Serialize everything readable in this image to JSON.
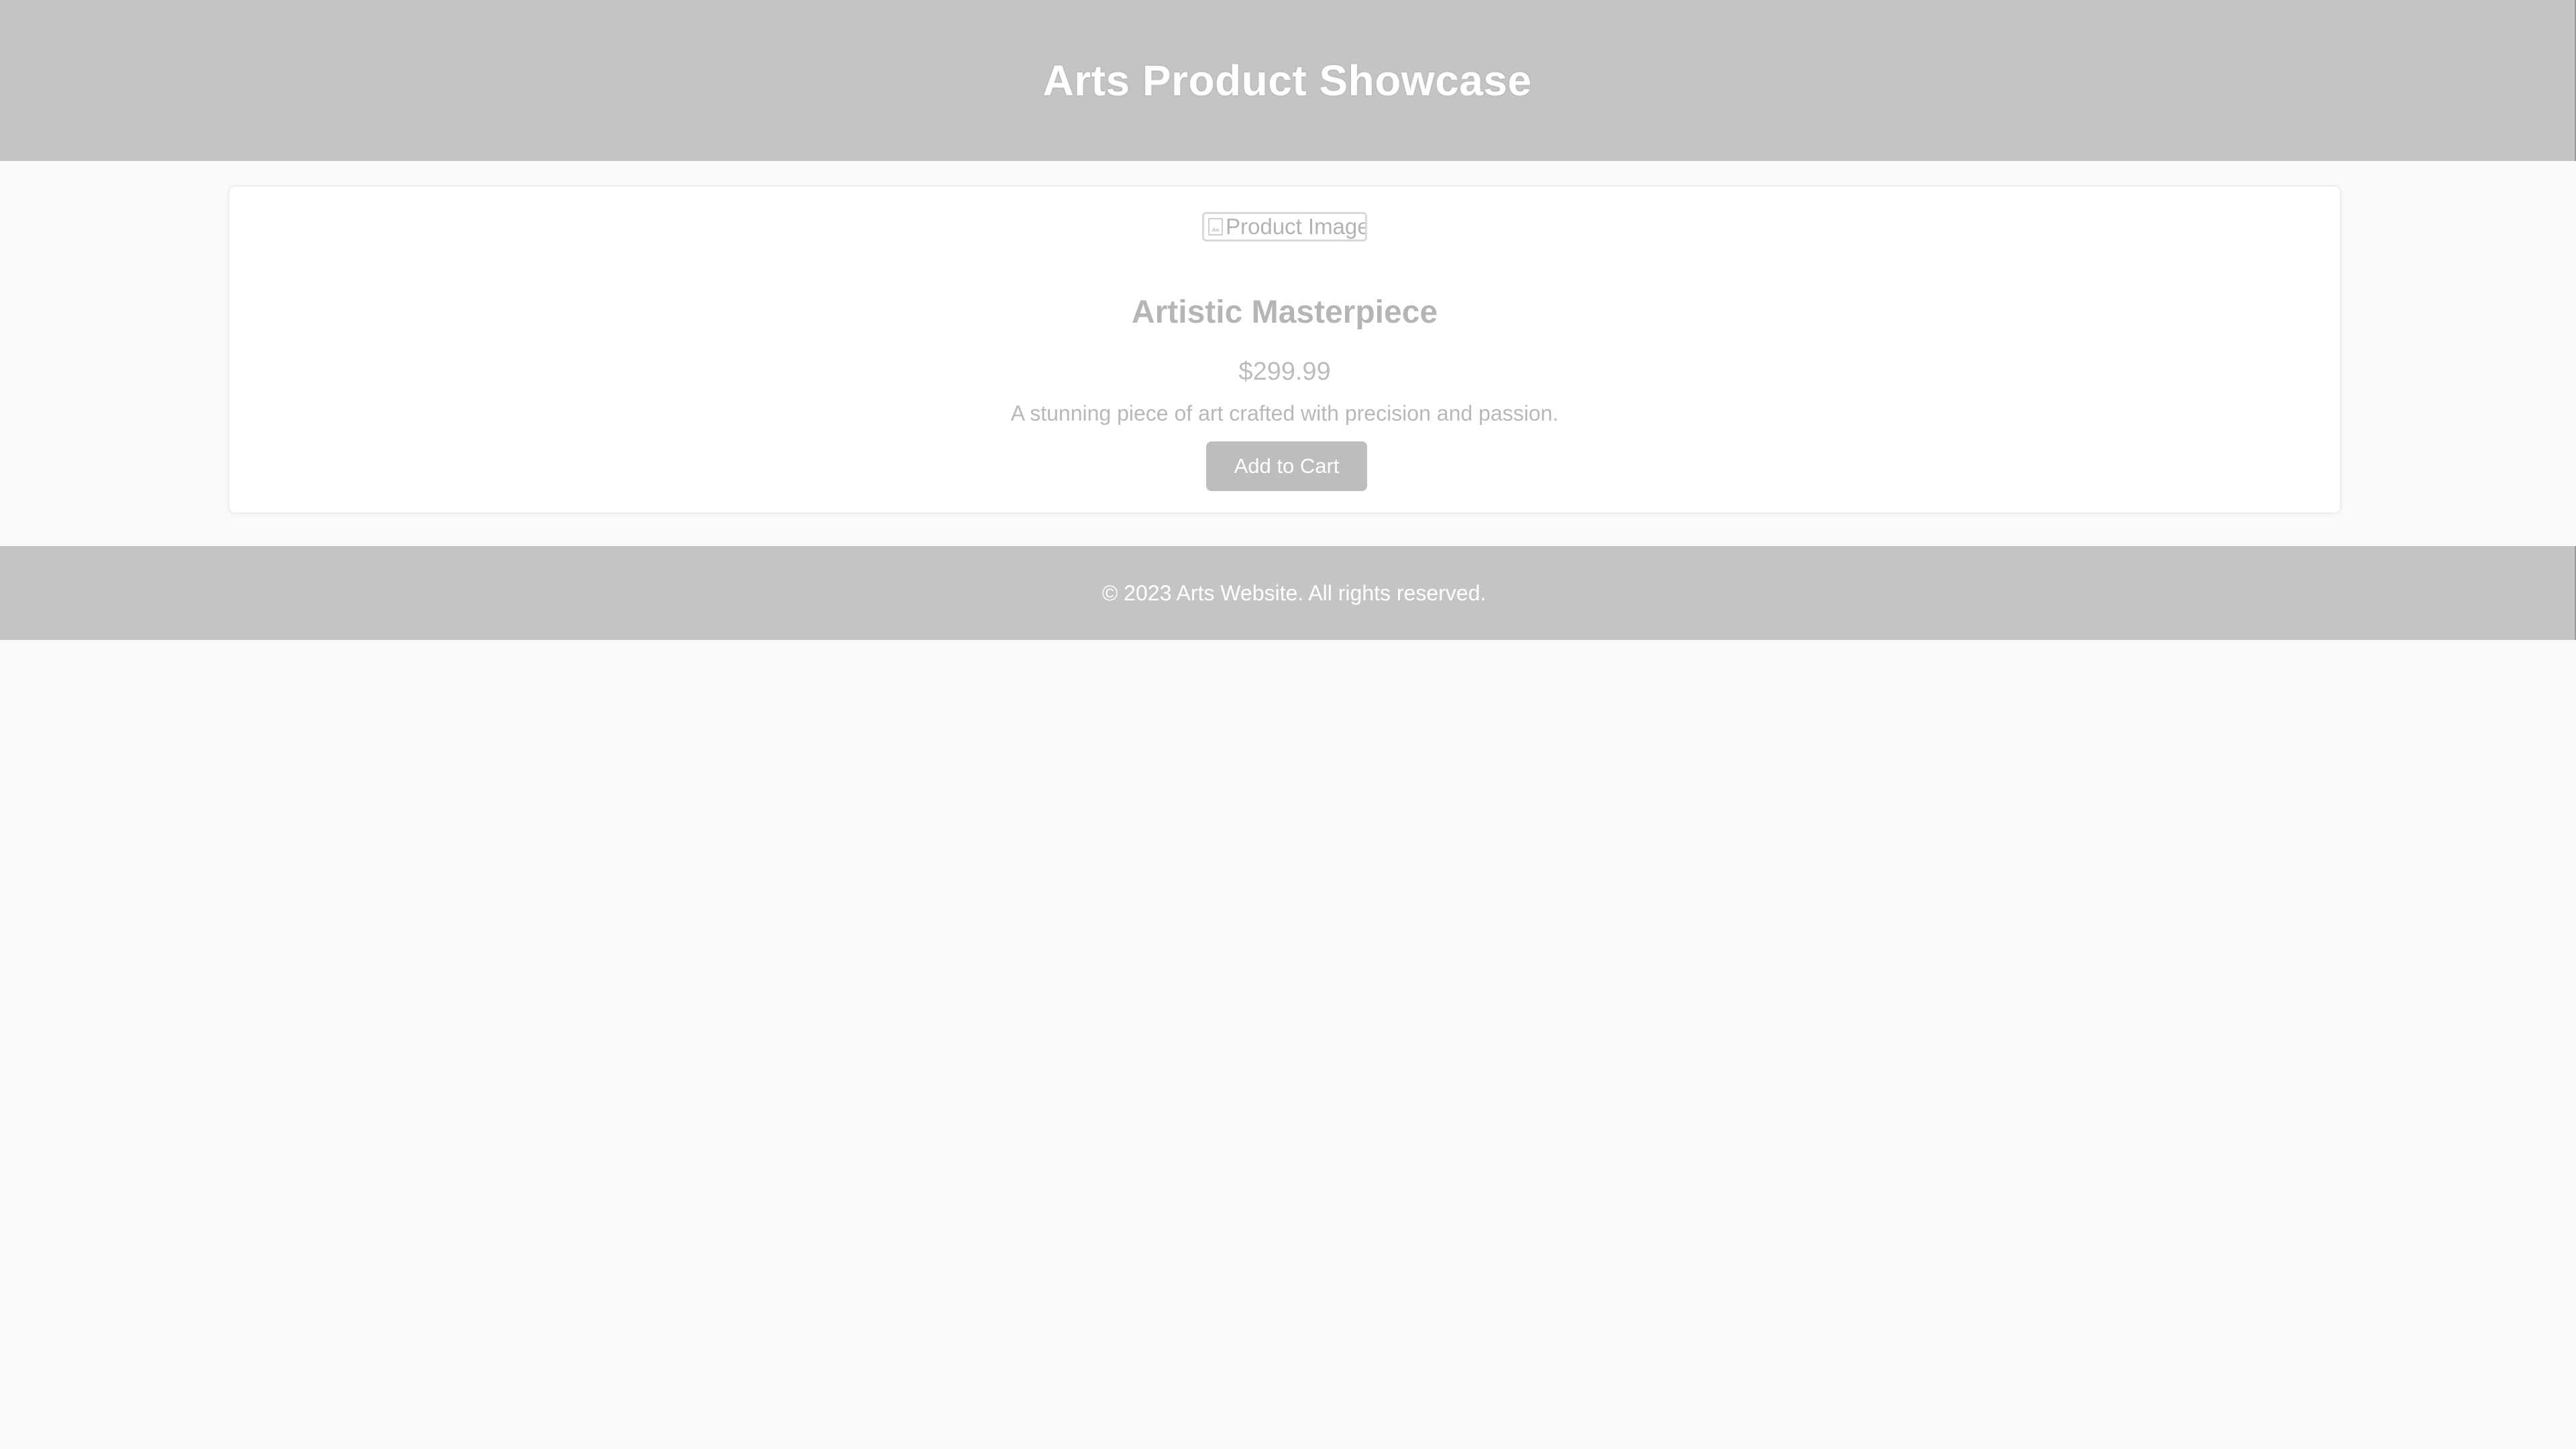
{
  "header": {
    "title": "Arts Product Showcase"
  },
  "product": {
    "image_alt": "Product Image",
    "name": "Artistic Masterpiece",
    "price": "$299.99",
    "description": "A stunning piece of art crafted with precision and passion.",
    "add_to_cart_label": "Add to Cart",
    "broken_image_icon": "broken-image-icon"
  },
  "footer": {
    "copyright": "© 2023 Arts Website. All rights reserved."
  },
  "colors": {
    "header_background": "#c4c4c4",
    "footer_background": "#c4c4c4",
    "page_background": "#fafafa",
    "button_background": "#bdbdbd",
    "text_muted": "#b5b5b5"
  }
}
